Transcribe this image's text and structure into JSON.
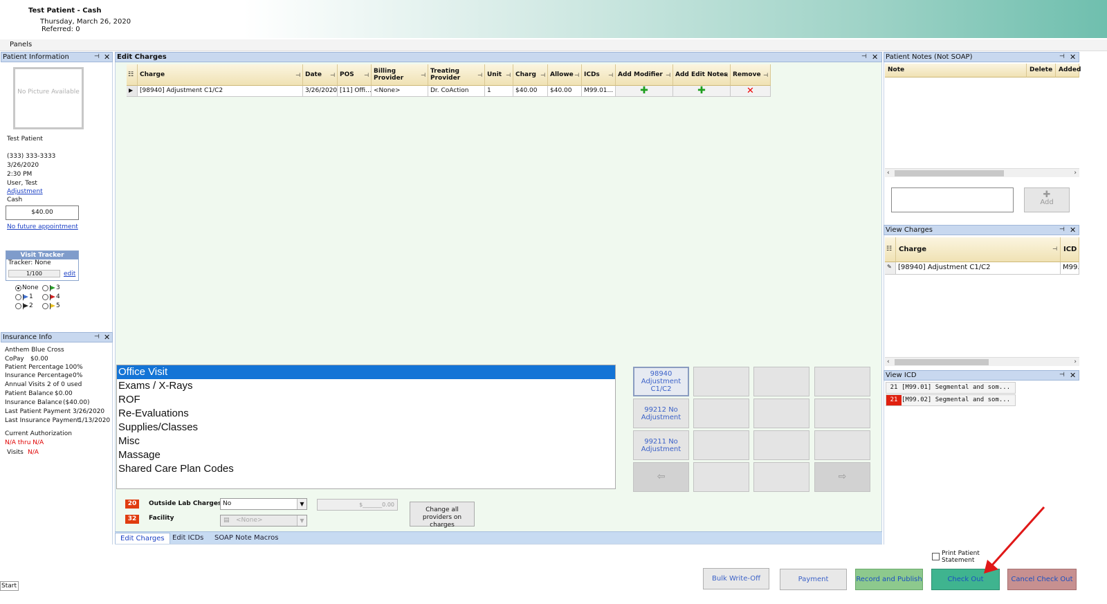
{
  "header": {
    "title": "Test Patient - Cash",
    "date": "Thursday, March 26, 2020",
    "referred": "Referred: 0"
  },
  "panels_label": "Panels",
  "patient_info": {
    "title": "Patient Information",
    "no_picture": "No Picture Available",
    "name": "Test Patient",
    "phone": "(333) 333-3333",
    "appt_date": "3/26/2020",
    "appt_time": "2:30 PM",
    "user": "User, Test",
    "visit_type": "Adjustment",
    "payment_type": "Cash",
    "balance": "$40.00",
    "future_appt": "No future appointment",
    "tracker_title": "Visit Tracker",
    "tracker_label": "Tracker: None",
    "tracker_value": "1/100",
    "tracker_edit": "edit",
    "radios": [
      {
        "label": "None",
        "checked": true
      },
      {
        "label": "1",
        "flag": "#3f6fcf"
      },
      {
        "label": "2",
        "flag": "#222222"
      },
      {
        "label": "3",
        "flag": "#2aa02a"
      },
      {
        "label": "4",
        "flag": "#d02020"
      },
      {
        "label": "5",
        "flag": "#e8c020"
      }
    ]
  },
  "insurance": {
    "title": "Insurance Info",
    "carrier": "Anthem Blue Cross",
    "rows": [
      {
        "k": "CoPay",
        "v": "$0.00"
      },
      {
        "k": "Patient Percentage",
        "v": "100%"
      },
      {
        "k": "Insurance Percentage",
        "v": "0%"
      },
      {
        "k": "Annual Visits",
        "v": "2 of 0 used"
      },
      {
        "k": "Patient Balance",
        "v": "$0.00"
      },
      {
        "k": "Insurance Balance",
        "v": "($40.00)"
      },
      {
        "k": "Last Patient Payment",
        "v": "3/26/2020"
      },
      {
        "k": "Last Insurance Payment",
        "v": "1/13/2020"
      }
    ],
    "auth_label": "Current Authorization",
    "auth_value": "N/A thru N/A",
    "visits_label": "Visits",
    "visits_value": "N/A"
  },
  "edit_charges": {
    "title": "Edit Charges",
    "columns": [
      "Charge",
      "Date",
      "POS",
      "Billing Provider",
      "Treating Provider",
      "Unit",
      "Charg",
      "Allowe",
      "ICDs",
      "Add Modifier",
      "Add Edit Notes",
      "Remove"
    ],
    "row": {
      "charge": "[98940] Adjustment C1/C2",
      "date": "3/26/2020",
      "pos": "[11] Offi...",
      "billing": "<None>",
      "treating": "Dr. CoAction",
      "unit": "1",
      "charge_amt": "$40.00",
      "allowed": "$40.00",
      "icds": "M99.01..."
    }
  },
  "categories": [
    "Office Visit",
    "Exams / X-Rays",
    "ROF",
    "Re-Evaluations",
    "Supplies/Classes",
    "Misc",
    "Massage",
    "Shared Care Plan Codes"
  ],
  "code_buttons": [
    "98940 Adjustment C1/C2",
    "99212 No Adjustment",
    "99211 No Adjustment"
  ],
  "bottom_fields": {
    "lab_badge": "20",
    "lab_label": "Outside Lab Charges",
    "lab_value": "No",
    "lab_amount": "$_______0.00",
    "facility_badge": "32",
    "facility_label": "Facility",
    "facility_value": "<None>",
    "change_providers": "Change all providers on charges"
  },
  "tabs": [
    "Edit Charges",
    "Edit ICDs",
    "SOAP Note Macros"
  ],
  "patient_notes": {
    "title": "Patient Notes (Not SOAP)",
    "col_note": "Note",
    "col_delete": "Delete",
    "col_added": "Added",
    "add_label": "Add"
  },
  "view_charges": {
    "title": "View Charges",
    "col_charge": "Charge",
    "col_icd": "ICD",
    "row_charge": "[98940] Adjustment C1/C2",
    "row_icd": "M99."
  },
  "view_icd": {
    "title": "View ICD",
    "items": [
      {
        "n": "21",
        "text": "[M99.01] Segmental and som..."
      },
      {
        "n": "21",
        "text": "[M99.02] Segmental and som..."
      }
    ]
  },
  "footer": {
    "print_statement": "Print Patient Statement",
    "bulk": "Bulk Write-Off",
    "payment": "Payment",
    "record": "Record and Publish",
    "checkout": "Check Out",
    "cancel": "Cancel Check Out",
    "start": "Start"
  },
  "colors": {
    "accent_blue": "#1374d6",
    "checkout": "#3fb48f",
    "record": "#8dc98d",
    "cancel": "#c79090",
    "arrow": "#e01818"
  }
}
